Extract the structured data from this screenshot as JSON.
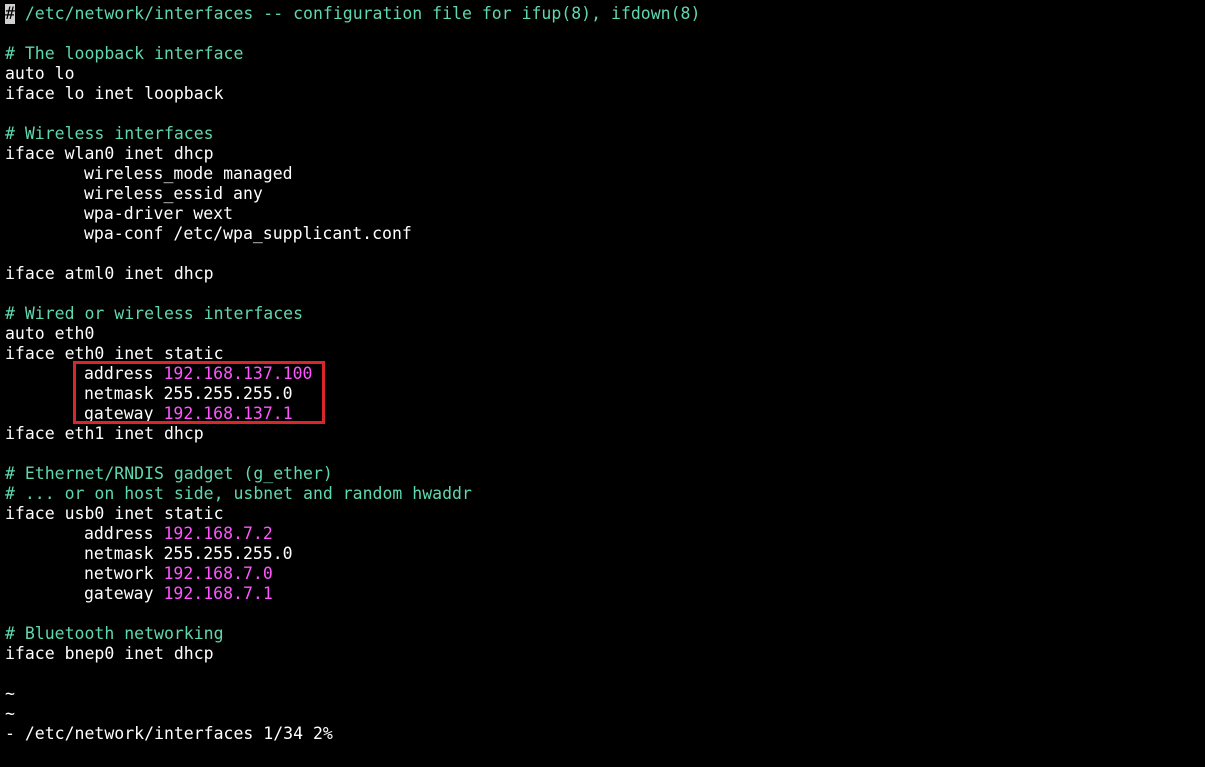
{
  "editor": {
    "header": {
      "cursor_char": "#",
      "text": " /etc/network/interfaces -- configuration file for ifup(8), ifdown(8)"
    },
    "comments": {
      "loopback": "# The loopback interface",
      "wireless": "# Wireless interfaces",
      "wired_or_wireless": "# Wired or wireless interfaces",
      "ethernet_rndis": "# Ethernet/RNDIS gadget (g_ether)",
      "host_side": "# ... or on host side, usbnet and random hwaddr",
      "bluetooth": "# Bluetooth networking"
    },
    "lines": {
      "auto_lo": "auto lo",
      "iface_lo": "iface lo inet loopback",
      "iface_wlan0": "iface wlan0 inet dhcp",
      "wireless_mode": "wireless_mode managed",
      "wireless_essid": "wireless_essid any",
      "wpa_driver": "wpa-driver wext",
      "wpa_conf": "wpa-conf /etc/wpa_supplicant.conf",
      "iface_atml0": "iface atml0 inet dhcp",
      "auto_eth0": "auto eth0",
      "iface_eth0": "iface eth0 inet static",
      "eth0_address_key": "address ",
      "eth0_address_val": "192.168.137.100",
      "eth0_netmask": "netmask 255.255.255.0",
      "eth0_gateway_key": "gateway ",
      "eth0_gateway_val": "192.168.137.1",
      "iface_eth1": "iface eth1 inet dhcp",
      "iface_usb0": "iface usb0 inet static",
      "usb0_address_key": "address ",
      "usb0_address_val": "192.168.7.2",
      "usb0_netmask": "netmask 255.255.255.0",
      "usb0_network_key": "network ",
      "usb0_network_val": "192.168.7.0",
      "usb0_gateway_key": "gateway ",
      "usb0_gateway_val": "192.168.7.1",
      "iface_bnep0": "iface bnep0 inet dhcp"
    },
    "tilde": "~",
    "status_line": "- /etc/network/interfaces 1/34 2%"
  },
  "colors": {
    "background": "#000000",
    "text": "#ffffff",
    "comment": "#5fd7af",
    "ip_literal": "#ff55ff",
    "highlight_border": "#d9262b"
  }
}
